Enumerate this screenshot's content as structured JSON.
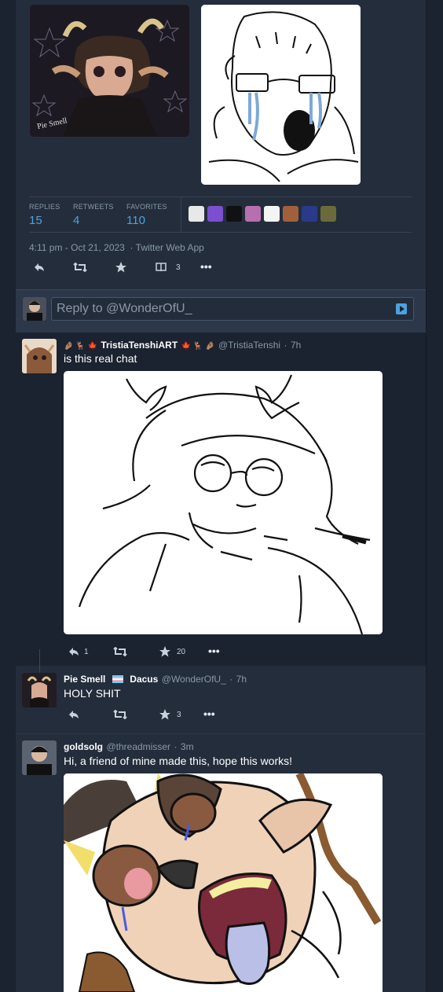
{
  "tweet": {
    "stats": {
      "replies_label": "REPLIES",
      "replies": "15",
      "retweets_label": "RETWEETS",
      "retweets": "4",
      "favorites_label": "FAVORITES",
      "favorites": "110"
    },
    "timestamp": "4:11 pm - Oct 21, 2023",
    "via": "Twitter Web App",
    "bookmark_count": "3",
    "image_signature": "Pie Smell"
  },
  "reply_box": {
    "placeholder": "Reply to @WonderOfU_"
  },
  "replies": [
    {
      "name": "TristiaTenshiART",
      "name_emoji_left": "🤌🏽 🦌 🍁",
      "name_emoji_right": "🍁 🦌 🤌🏽",
      "handle": "@TristiaTenshi",
      "time": "7h",
      "text": "is this real chat",
      "reply_count": "1",
      "fav_count": "20"
    },
    {
      "name": "Pie Smell",
      "name_suffix": "Dacus",
      "handle": "@WonderOfU_",
      "time": "7h",
      "text": "HOLY SHIT",
      "fav_count": "3"
    },
    {
      "name": "goldsolg",
      "handle": "@threadmisser",
      "time": "3m",
      "text": "Hi, a friend of mine made this, hope this works!"
    }
  ],
  "icons": [
    "reply-icon",
    "retweet-icon",
    "favorite-icon",
    "bookmark-icon",
    "more-icon",
    "send-icon"
  ],
  "colors": {
    "accent": "#4aa3df",
    "background": "#1b2230",
    "panel": "#242d3c"
  }
}
